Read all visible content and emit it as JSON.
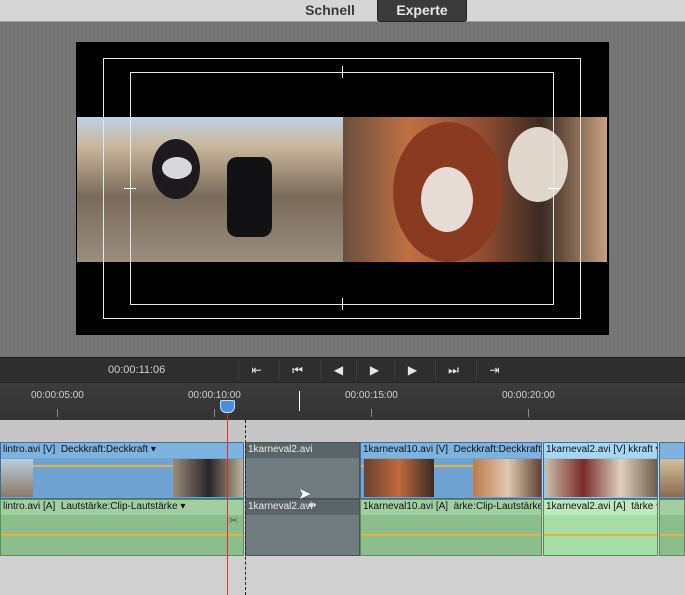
{
  "modes": {
    "schnell": "Schnell",
    "experte": "Experte"
  },
  "monitor": {
    "timecode": "00:00:11:06"
  },
  "ruler": {
    "labels": [
      "00:00:05:00",
      "00:00:10:00",
      "00:00:15:00",
      "00:00:20:00"
    ]
  },
  "transport": {
    "buttons": [
      "goto-in",
      "goto-start",
      "step-back",
      "play",
      "step-forward",
      "goto-end",
      "goto-out"
    ]
  },
  "tracks": {
    "video": [
      {
        "label": "lintro.avi [V]",
        "effect": "Deckkraft:Deckkraft ▾"
      },
      {
        "label": "1karneval2.avi",
        "effect": ""
      },
      {
        "label": "1karneval10.avi [V]",
        "effect": "Deckkraft:Deckkraft ▾"
      },
      {
        "label": "1karneval2.avi [V]",
        "effect": "kkraft ▾"
      }
    ],
    "audio": [
      {
        "label": "lintro.avi [A]",
        "effect": "Lautstärke:Clip-Lautstärke ▾"
      },
      {
        "label": "1karneval2.avi",
        "effect": ""
      },
      {
        "label": "1karneval10.avi [A]",
        "effect": "ärke:Clip-Lautstärke ▾"
      },
      {
        "label": "1karneval2.avi [A]",
        "effect": "tärke ▾"
      }
    ]
  },
  "colors": {
    "accent": "#4a90d8",
    "playhead": "#e03030",
    "video_clip": "#6fa4d2",
    "audio_clip": "#8cbe8c"
  },
  "icons": {
    "goto-in": "⇤",
    "goto-start": "⏮",
    "step-back": "◀",
    "play": "▶",
    "step-forward": "▶",
    "goto-end": "⏭",
    "goto-out": "⇥"
  }
}
